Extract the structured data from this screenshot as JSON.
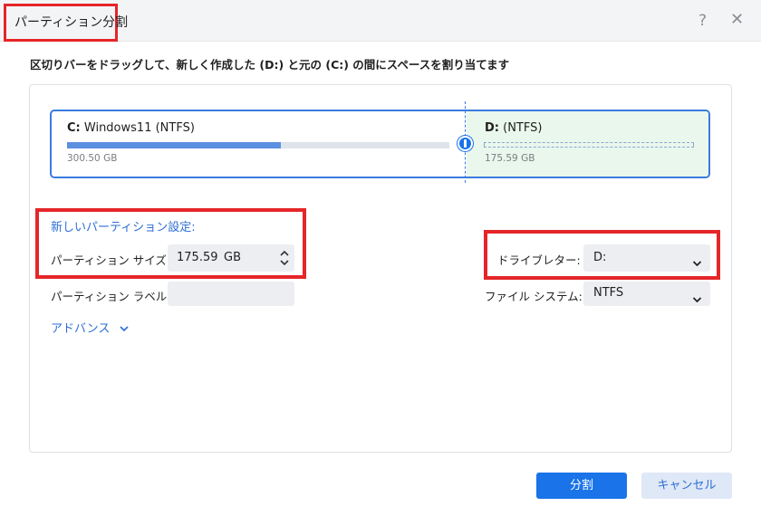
{
  "window": {
    "title": "パーティション分割",
    "help_icon": "?",
    "close_icon": "✕"
  },
  "instruction": "区切りバーをドラッグして、新しく作成した (D:) と元の (C:) の間にスペースを割り当てます",
  "disk": {
    "partition_c": {
      "letter": "C:",
      "name": "Windows11 (NTFS)",
      "size": "300.50 GB",
      "used_fraction": 0.56
    },
    "partition_d": {
      "letter": "D:",
      "name": "(NTFS)",
      "size": "175.59 GB"
    }
  },
  "settings": {
    "section_title": "新しいパーティション設定:",
    "size_label": "パーティション サイズ:",
    "size_value": "175.59",
    "size_unit": "GB",
    "volume_label": "パーティション ラベル:",
    "volume_value": "",
    "advanced": "アドバンス"
  },
  "drive_letter": {
    "label": "ドライブレター:",
    "value": "D:"
  },
  "file_system": {
    "label": "ファイル システム:",
    "value": "NTFS"
  },
  "buttons": {
    "split": "分割",
    "cancel": "キャンセル"
  },
  "colors": {
    "accent": "#1a73e8",
    "highlight_box": "#e52629",
    "link": "#2d6fd6",
    "new_partition_bg": "#e9f7ec"
  }
}
